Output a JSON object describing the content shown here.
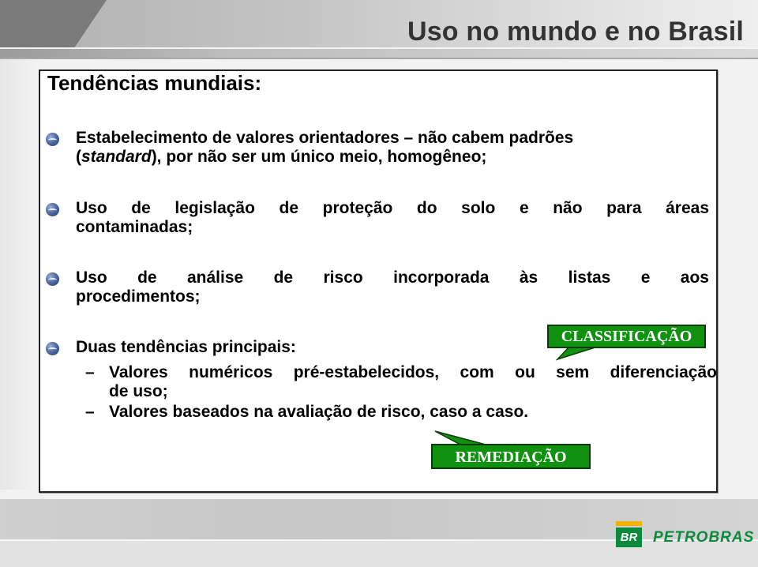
{
  "slide": {
    "title": "Uso no mundo e no Brasil",
    "subheading": "Tendências mundiais:",
    "bullets": [
      {
        "line1": "Estabelecimento de valores orientadores – não cabem padrões",
        "line2_pre": "(",
        "line2_italic": "standard",
        "line2_post": "), por não ser um único meio, homogêneo;"
      },
      {
        "line1": "Uso de legislação de proteção do solo e não para áreas",
        "line2": "contaminadas;"
      },
      {
        "line1": "Uso de análise de risco incorporada às listas e aos",
        "line2": "procedimentos;"
      },
      {
        "line1": "Duas tendências principais:"
      }
    ],
    "sub_items": [
      {
        "dash": "–",
        "line1": "Valores numéricos pré-estabelecidos, com ou sem diferenciação",
        "line2": "de uso;"
      },
      {
        "dash": "–",
        "line1": "Valores baseados na avaliação de risco, caso a caso."
      }
    ],
    "callouts": {
      "classificacao": "CLASSIFICAÇÃO",
      "remediacao": "REMEDIAÇÃO"
    },
    "colors": {
      "callout_green": "#109210",
      "logo_green": "#0b8a3b",
      "logo_yellow": "#f2b203"
    }
  },
  "footer": {
    "logo_mark": "BR",
    "logo_text": "PETROBRAS"
  }
}
